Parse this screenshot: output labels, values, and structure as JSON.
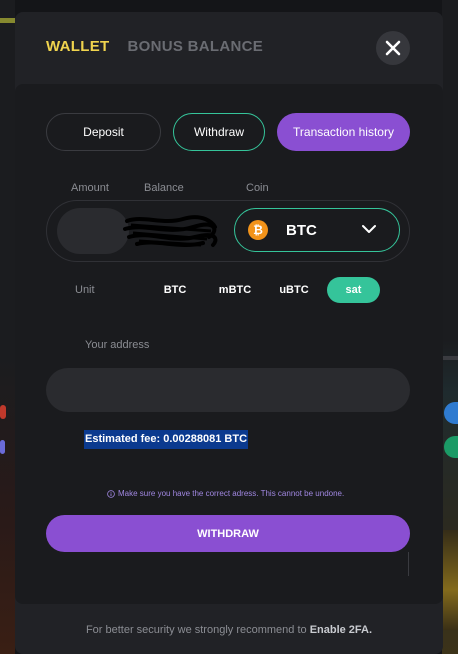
{
  "modal": {
    "tabs": [
      {
        "label": "WALLET",
        "active": true
      },
      {
        "label": "BONUS BALANCE",
        "active": false
      }
    ],
    "close_icon": "close-icon"
  },
  "actions": {
    "deposit": "Deposit",
    "withdraw": "Withdraw",
    "history": "Transaction history"
  },
  "form": {
    "amount_label": "Amount",
    "balance_label": "Balance",
    "coin_label": "Coin",
    "amount_value": "",
    "balance_value": "",
    "coin": {
      "symbol": "BTC",
      "icon": "bitcoin-icon",
      "color": "#f2931a"
    },
    "unit_label": "Unit",
    "units": [
      "BTC",
      "mBTC",
      "uBTC",
      "sat"
    ],
    "selected_unit": "sat",
    "address_label": "Your address",
    "address_value": "",
    "fee_text": "Estimated fee: 0.00288081 BTC",
    "warning_text": "Make sure you have the correct adress. This cannot be undone.",
    "submit_label": "WITHDRAW"
  },
  "footer": {
    "text": "For better security we strongly recommend to ",
    "link": "Enable 2FA."
  },
  "colors": {
    "accent_yellow": "#f0d44e",
    "accent_purple": "#8a4fd2",
    "accent_green": "#35c49a"
  }
}
